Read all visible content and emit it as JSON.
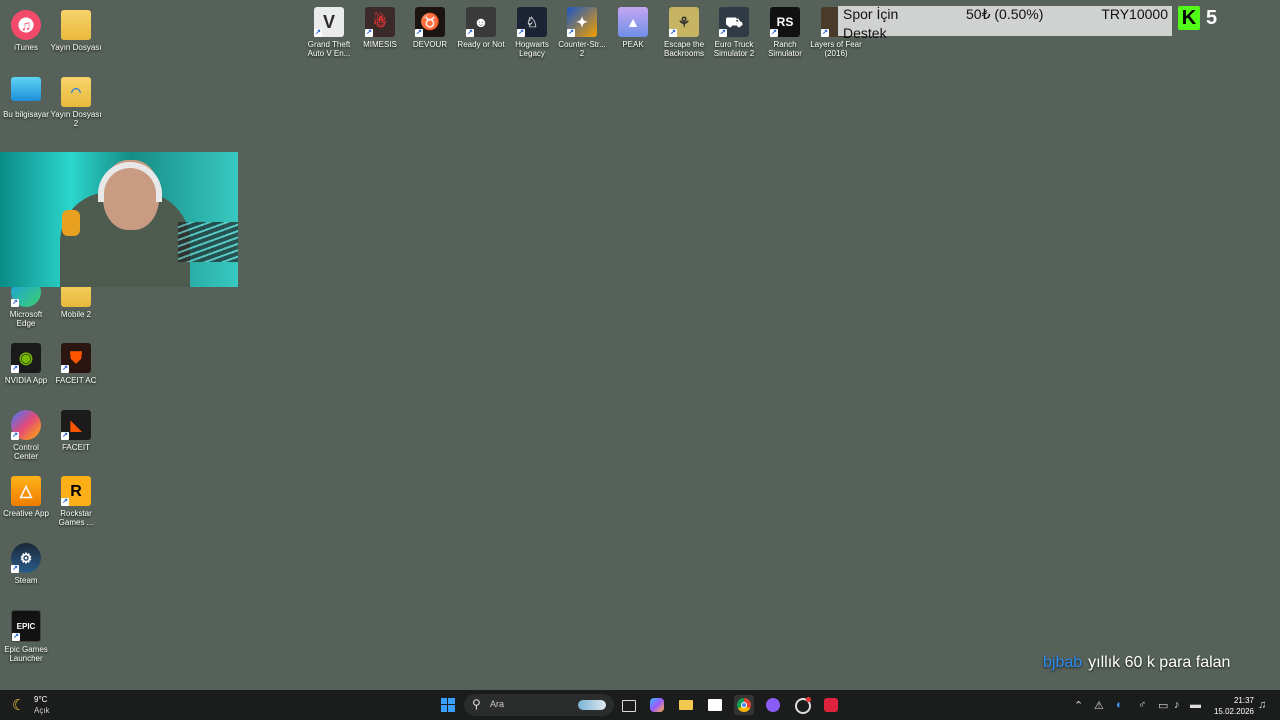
{
  "desktop": {
    "left_icons": [
      {
        "label": "iTunes",
        "icon": "itunes-icon",
        "color": "#f34a6a"
      },
      {
        "label": "Yayın Dosyası",
        "icon": "folder-icon",
        "color": "#f3c84f"
      },
      {
        "label": "Bu bilgisayar",
        "icon": "computer-icon",
        "color": "#2aa8e8"
      },
      {
        "label": "Yayın Dosyası 2",
        "icon": "folder-icon",
        "color": "#f3c84f"
      },
      {
        "label": "Microsoft Edge",
        "icon": "edge-icon",
        "color": "#1b9de2"
      },
      {
        "label": "Mobile 2",
        "icon": "folder-icon",
        "color": "#f3c84f"
      },
      {
        "label": "NVIDIA App",
        "icon": "nvidia-icon",
        "color": "#76b900"
      },
      {
        "label": "FACEIT AC",
        "icon": "faceit-ac-icon",
        "color": "#ff5500"
      },
      {
        "label": "Control Center",
        "icon": "control-center-icon",
        "color": "#e24a7a"
      },
      {
        "label": "FACEIT",
        "icon": "faceit-icon",
        "color": "#ff5500"
      },
      {
        "label": "Creative App",
        "icon": "creative-app-icon",
        "color": "#f59a16"
      },
      {
        "label": "Rockstar Games ...",
        "icon": "rockstar-icon",
        "color": "#fcaf17"
      },
      {
        "label": "Steam",
        "icon": "steam-icon",
        "color": "#1b2838"
      },
      {
        "label": "Epic Games Launcher",
        "icon": "epic-games-icon",
        "color": "#121212"
      }
    ],
    "top_icons": [
      {
        "label": "Grand Theft Auto V En...",
        "icon": "gta-v-icon"
      },
      {
        "label": "MIMESIS",
        "icon": "mimesis-icon"
      },
      {
        "label": "DEVOUR",
        "icon": "devour-icon"
      },
      {
        "label": "Ready or Not",
        "icon": "ready-or-not-icon"
      },
      {
        "label": "Hogwarts Legacy",
        "icon": "hogwarts-legacy-icon"
      },
      {
        "label": "Counter-Str... 2",
        "icon": "counter-strike-icon"
      },
      {
        "label": "PEAK",
        "icon": "peak-icon"
      },
      {
        "label": "Escape the Backrooms",
        "icon": "escape-backrooms-icon"
      },
      {
        "label": "Euro Truck Simulator 2",
        "icon": "euro-truck-icon"
      },
      {
        "label": "Ranch Simulator",
        "icon": "ranch-simulator-icon"
      },
      {
        "label": "Layers of Fear (2016)",
        "icon": "layers-of-fear-icon"
      }
    ]
  },
  "overlay": {
    "donation_title_1": "Spor İçin",
    "donation_title_2": "Destek",
    "donation_amount": "50₺ (0.50%)",
    "donation_goal": "TRY10000",
    "kick_logo": "K",
    "viewer_count": "5",
    "chat_user": "bjbab",
    "chat_message": "yıllık 60 k para falan"
  },
  "taskbar": {
    "weather_temp": "9°C",
    "weather_desc": "Açık",
    "search_placeholder": "Ara",
    "time": "21:37",
    "date": "15.02.2026"
  },
  "colors": {
    "desktop_bg": "#566159",
    "kick_green": "#53fc18",
    "chat_user": "#2d8cf0",
    "taskbar_bg": "#1b1d1c"
  }
}
